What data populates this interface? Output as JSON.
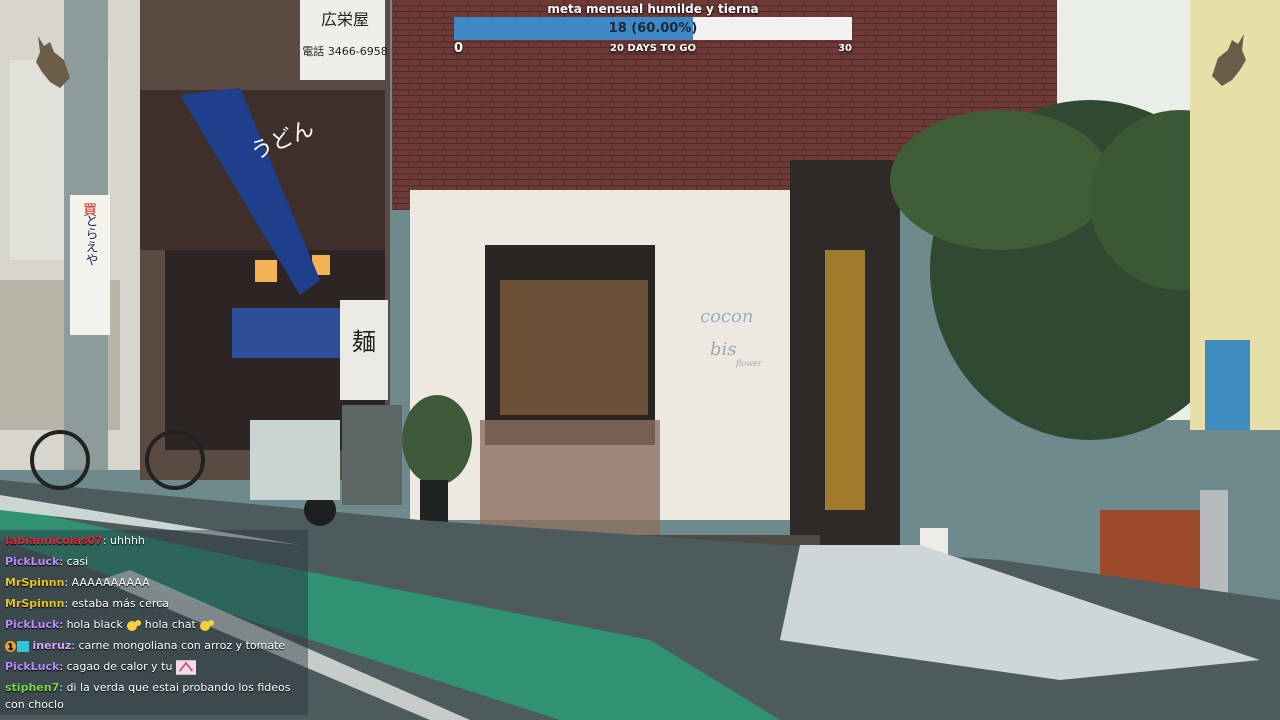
{
  "goal": {
    "title": "meta mensual humilde y tierna",
    "value_label": "18 (60.00%)",
    "progress_fraction": 0.6,
    "min_label": "0",
    "days_label": "20 DAYS TO GO",
    "max_label": "30",
    "fill_color": "#3f88c5"
  },
  "chat": [
    {
      "user": "fabiannicolas07",
      "color": "#e0243a",
      "sep": ": ",
      "text": "uhhhh",
      "extras": []
    },
    {
      "user": "PickLuck",
      "color": "#b88bff",
      "sep": ": ",
      "text": "casi",
      "extras": []
    },
    {
      "user": "MrSpinnn",
      "color": "#e5c320",
      "sep": ": ",
      "text": "AAAAAAAAAA",
      "extras": []
    },
    {
      "user": "MrSpinnn",
      "color": "#e5c320",
      "sep": ": ",
      "text": "estaba más cerca",
      "extras": []
    },
    {
      "user": "PickLuck",
      "color": "#b88bff",
      "sep": ": ",
      "text": "hola black",
      "text2": "hola chat",
      "extras": [
        "emote-1",
        "emote-2"
      ]
    },
    {
      "user": "ineruz",
      "color": "#d7a6ff",
      "sep": ": ",
      "text": "carne mongoliana con arroz y tomate",
      "extras": [
        "badge"
      ]
    },
    {
      "user": "PickLuck",
      "color": "#b88bff",
      "sep": ": ",
      "text": "cagao de calor y tu",
      "extras": [
        "emote-3"
      ]
    },
    {
      "user": "stiphen7",
      "color": "#7ad64a",
      "sep": ": ",
      "text": "di la verda que estai probando los fideos con choclo",
      "extras": []
    }
  ],
  "scene": {
    "shop_sign_vertical": "うどん",
    "sign_phone": "電話 3466-6958",
    "sign_shop": "広栄屋",
    "sign_left": "とらえや",
    "noodle_kanji": "麺",
    "window_text": "cocon",
    "window_text2": "bis",
    "window_text3": "flower"
  },
  "icons": [
    "wolf-icon",
    "badge-icon",
    "emote-icon"
  ]
}
